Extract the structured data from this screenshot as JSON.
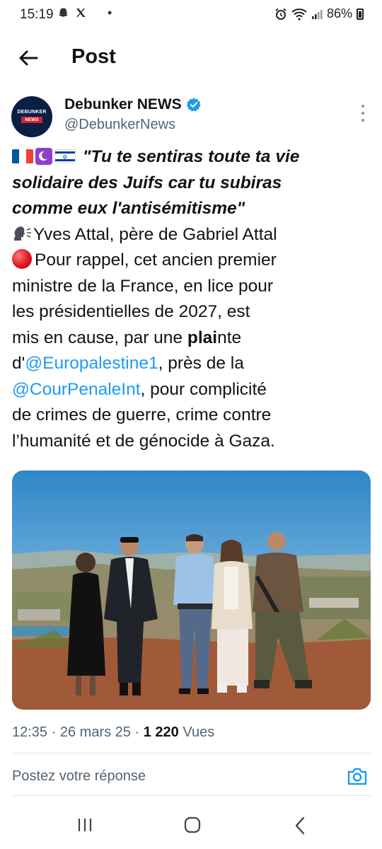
{
  "status_bar": {
    "time": "15:19",
    "battery": "86%"
  },
  "header": {
    "title": "Post"
  },
  "author": {
    "name": "Debunker NEWS",
    "handle": "@DebunkerNews",
    "avatar_top": "DEBUNKER",
    "avatar_bottom": "NEWS"
  },
  "post": {
    "quote_line1": "\"Tu te sentiras toute ta vie",
    "quote_line2": "solidaire des Juifs car tu subiras",
    "quote_line3": "comme eux l'antisémitisme\"",
    "speaker": "Yves Attal, père de Gabriel Attal",
    "line5": "Pour rappel, cet ancien premier",
    "line6": "ministre de la France, en lice pour",
    "line7": "les présidentielles de 2027, est",
    "line8_a": "mis en cause, par une ",
    "line8_b": "plai",
    "line8_c": "nte",
    "line9_a": "d'",
    "mention1": "@Europalestine1",
    "line9_b": ", près de la",
    "mention2": "@CourPenaleInt",
    "line10_b": ", pour complicité",
    "line11": "de crimes de guerre, crime contre",
    "line12": "l’humanité et de génocide à Gaza."
  },
  "meta": {
    "time": "12:35",
    "date": "26 mars 25",
    "views_count": "1 220",
    "views_label": "Vues",
    "separator": "·"
  },
  "reply": {
    "placeholder": "Postez votre réponse"
  },
  "colors": {
    "accent": "#1d9bf0",
    "text": "#0f1419",
    "secondary": "#536471"
  }
}
